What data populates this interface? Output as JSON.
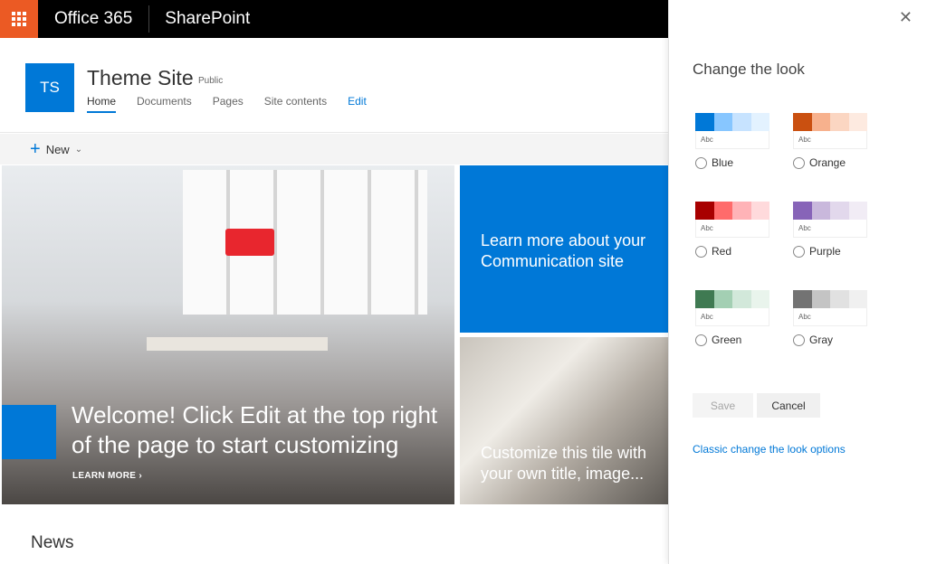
{
  "topbar": {
    "app_launcher_icon": "waffle-icon",
    "brand": "Office 365",
    "app": "SharePoint",
    "launcher_color": "#eb5a24"
  },
  "site": {
    "logo_initials": "TS",
    "title": "Theme Site",
    "privacy": "Public",
    "nav": [
      {
        "label": "Home",
        "active": true
      },
      {
        "label": "Documents"
      },
      {
        "label": "Pages"
      },
      {
        "label": "Site contents"
      },
      {
        "label": "Edit"
      }
    ]
  },
  "command_bar": {
    "new_label": "New"
  },
  "hero": {
    "main_text": "Welcome! Click Edit at the top right of the page to start customizing",
    "learn_more": "LEARN MORE",
    "tile1_text": "Learn more about your Communication site",
    "tile2_text": "Customize this tile with your own title, image..."
  },
  "news": {
    "heading": "News"
  },
  "panel": {
    "title": "Change the look",
    "themes": [
      {
        "name": "Blue",
        "sample": "Abc",
        "colors": [
          "#0078d7",
          "#87c6ff",
          "#c7e3ff",
          "#e3f2ff"
        ]
      },
      {
        "name": "Orange",
        "sample": "Abc",
        "colors": [
          "#ca5010",
          "#f7b18d",
          "#fbd6c2",
          "#fdeae0"
        ]
      },
      {
        "name": "Red",
        "sample": "Abc",
        "colors": [
          "#a80000",
          "#ff6b6b",
          "#ffb3b7",
          "#ffdadc"
        ]
      },
      {
        "name": "Purple",
        "sample": "Abc",
        "colors": [
          "#8764b8",
          "#c9b8dc",
          "#e2d8ec",
          "#f1ecf5"
        ]
      },
      {
        "name": "Green",
        "sample": "Abc",
        "colors": [
          "#3f7a52",
          "#a3cfb3",
          "#d2e8da",
          "#e9f4ec"
        ]
      },
      {
        "name": "Gray",
        "sample": "Abc",
        "colors": [
          "#737373",
          "#c4c4c4",
          "#e1e1e1",
          "#f0f0f0"
        ]
      }
    ],
    "save": "Save",
    "cancel": "Cancel",
    "classic_link": "Classic change the look options"
  }
}
